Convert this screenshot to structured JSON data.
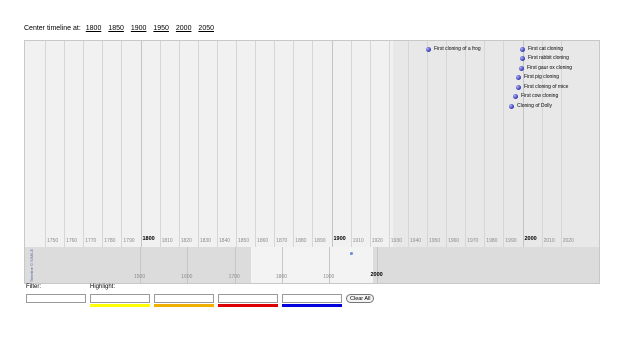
{
  "center_bar": {
    "label": "Center timeline at:",
    "links": [
      "1800",
      "1850",
      "1900",
      "1950",
      "2000",
      "2050"
    ]
  },
  "upper_band": {
    "years": [
      "1750",
      "1760",
      "1770",
      "1780",
      "1790",
      "1800",
      "1810",
      "1820",
      "1830",
      "1840",
      "1850",
      "1860",
      "1870",
      "1880",
      "1890",
      "1900",
      "1910",
      "1920",
      "1930",
      "1940",
      "1950",
      "1960",
      "1970",
      "1980",
      "1990",
      "2000",
      "2010",
      "2020"
    ],
    "major_years": [
      "1800",
      "1900",
      "2000"
    ]
  },
  "lower_band": {
    "labels": [
      "1500",
      "1600",
      "1700",
      "1800",
      "1900",
      "2000"
    ],
    "major_labels": [
      "2000"
    ]
  },
  "events": [
    {
      "title": "First cloning of a frog",
      "color": "#2a2fa8"
    },
    {
      "title": "First cat cloning",
      "color": "#2a2fa8"
    },
    {
      "title": "First rabbit cloning",
      "color": "#2a2fa8"
    },
    {
      "title": "First gaur ox cloning",
      "color": "#2a2fa8"
    },
    {
      "title": "First pig cloning",
      "color": "#2a2fa8"
    },
    {
      "title": "First cloning of mice",
      "color": "#2a2fa8"
    },
    {
      "title": "First cow cloning",
      "color": "#2a2fa8"
    },
    {
      "title": "Cloning of Dolly",
      "color": "#2a2fa8"
    }
  ],
  "side_credit": "Timeline © SIMILE",
  "controls": {
    "filter_label": "Filter:",
    "highlight_label": "Highlight:",
    "clear_label": "Clear All",
    "highlight_colors": [
      "#ffff00",
      "#f0b000",
      "#dd0000",
      "#0000dd"
    ]
  }
}
